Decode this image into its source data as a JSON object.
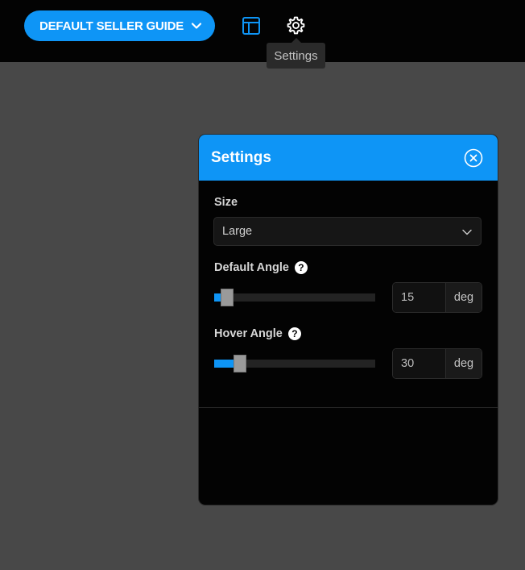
{
  "topbar": {
    "guide_button_label": "DEFAULT SELLER GUIDE",
    "tooltip": "Settings"
  },
  "settings": {
    "title": "Settings",
    "size": {
      "label": "Size",
      "value": "Large"
    },
    "default_angle": {
      "label": "Default Angle",
      "value": "15",
      "unit": "deg",
      "slider_fraction": 0.08
    },
    "hover_angle": {
      "label": "Hover Angle",
      "value": "30",
      "unit": "deg",
      "slider_fraction": 0.16
    }
  },
  "colors": {
    "accent": "#0e95f6",
    "background": "#484848",
    "panel": "#030303"
  },
  "icons": {
    "layout": "layout-icon",
    "settings": "gear-icon",
    "close": "close-icon",
    "help": "help-icon",
    "dropdown": "chevron-down-icon"
  }
}
